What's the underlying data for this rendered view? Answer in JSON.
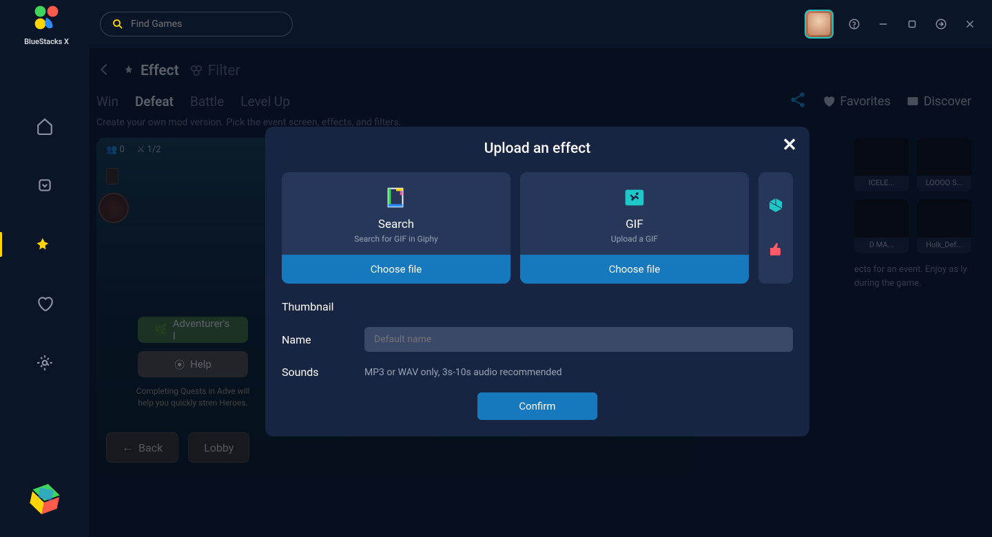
{
  "brand": "BlueStacks X",
  "search": {
    "placeholder": "Find Games"
  },
  "breadcrumb": {
    "effect": "Effect",
    "filter": "Filter"
  },
  "tabs": {
    "win": "Win",
    "defeat": "Defeat",
    "battle": "Battle",
    "levelup": "Level Up"
  },
  "subtext": "Create your own mod version. Pick the event screen, effects, and filters.",
  "right_links": {
    "favorites": "Favorites",
    "discover": "Discover"
  },
  "game_preview": {
    "count0": "0",
    "count1": "1/2",
    "adventurer": "Adventurer's I",
    "help": "Help",
    "quest": "Completing Quests in Adve will help you quickly stren Heroes.",
    "back": "Back",
    "lobby": "Lobby"
  },
  "cards": {
    "c1": "ICELE...",
    "c2": "LOOOO S...",
    "c3": "D MA...",
    "c4": "Hulk_Def..."
  },
  "cards_text": "ects for an event. Enjoy as ly during the game.",
  "modal": {
    "title": "Upload an effect",
    "search": {
      "title": "Search",
      "sub": "Search for GIF in Giphy",
      "btn": "Choose file"
    },
    "gif": {
      "title": "GIF",
      "sub": "Upload a GIF",
      "btn": "Choose file"
    },
    "thumbnail": "Thumbnail",
    "name": "Name",
    "name_placeholder": "Default name",
    "sounds": "Sounds",
    "sounds_hint": "MP3 or WAV only, 3s-10s audio recommended",
    "confirm": "Confirm"
  }
}
